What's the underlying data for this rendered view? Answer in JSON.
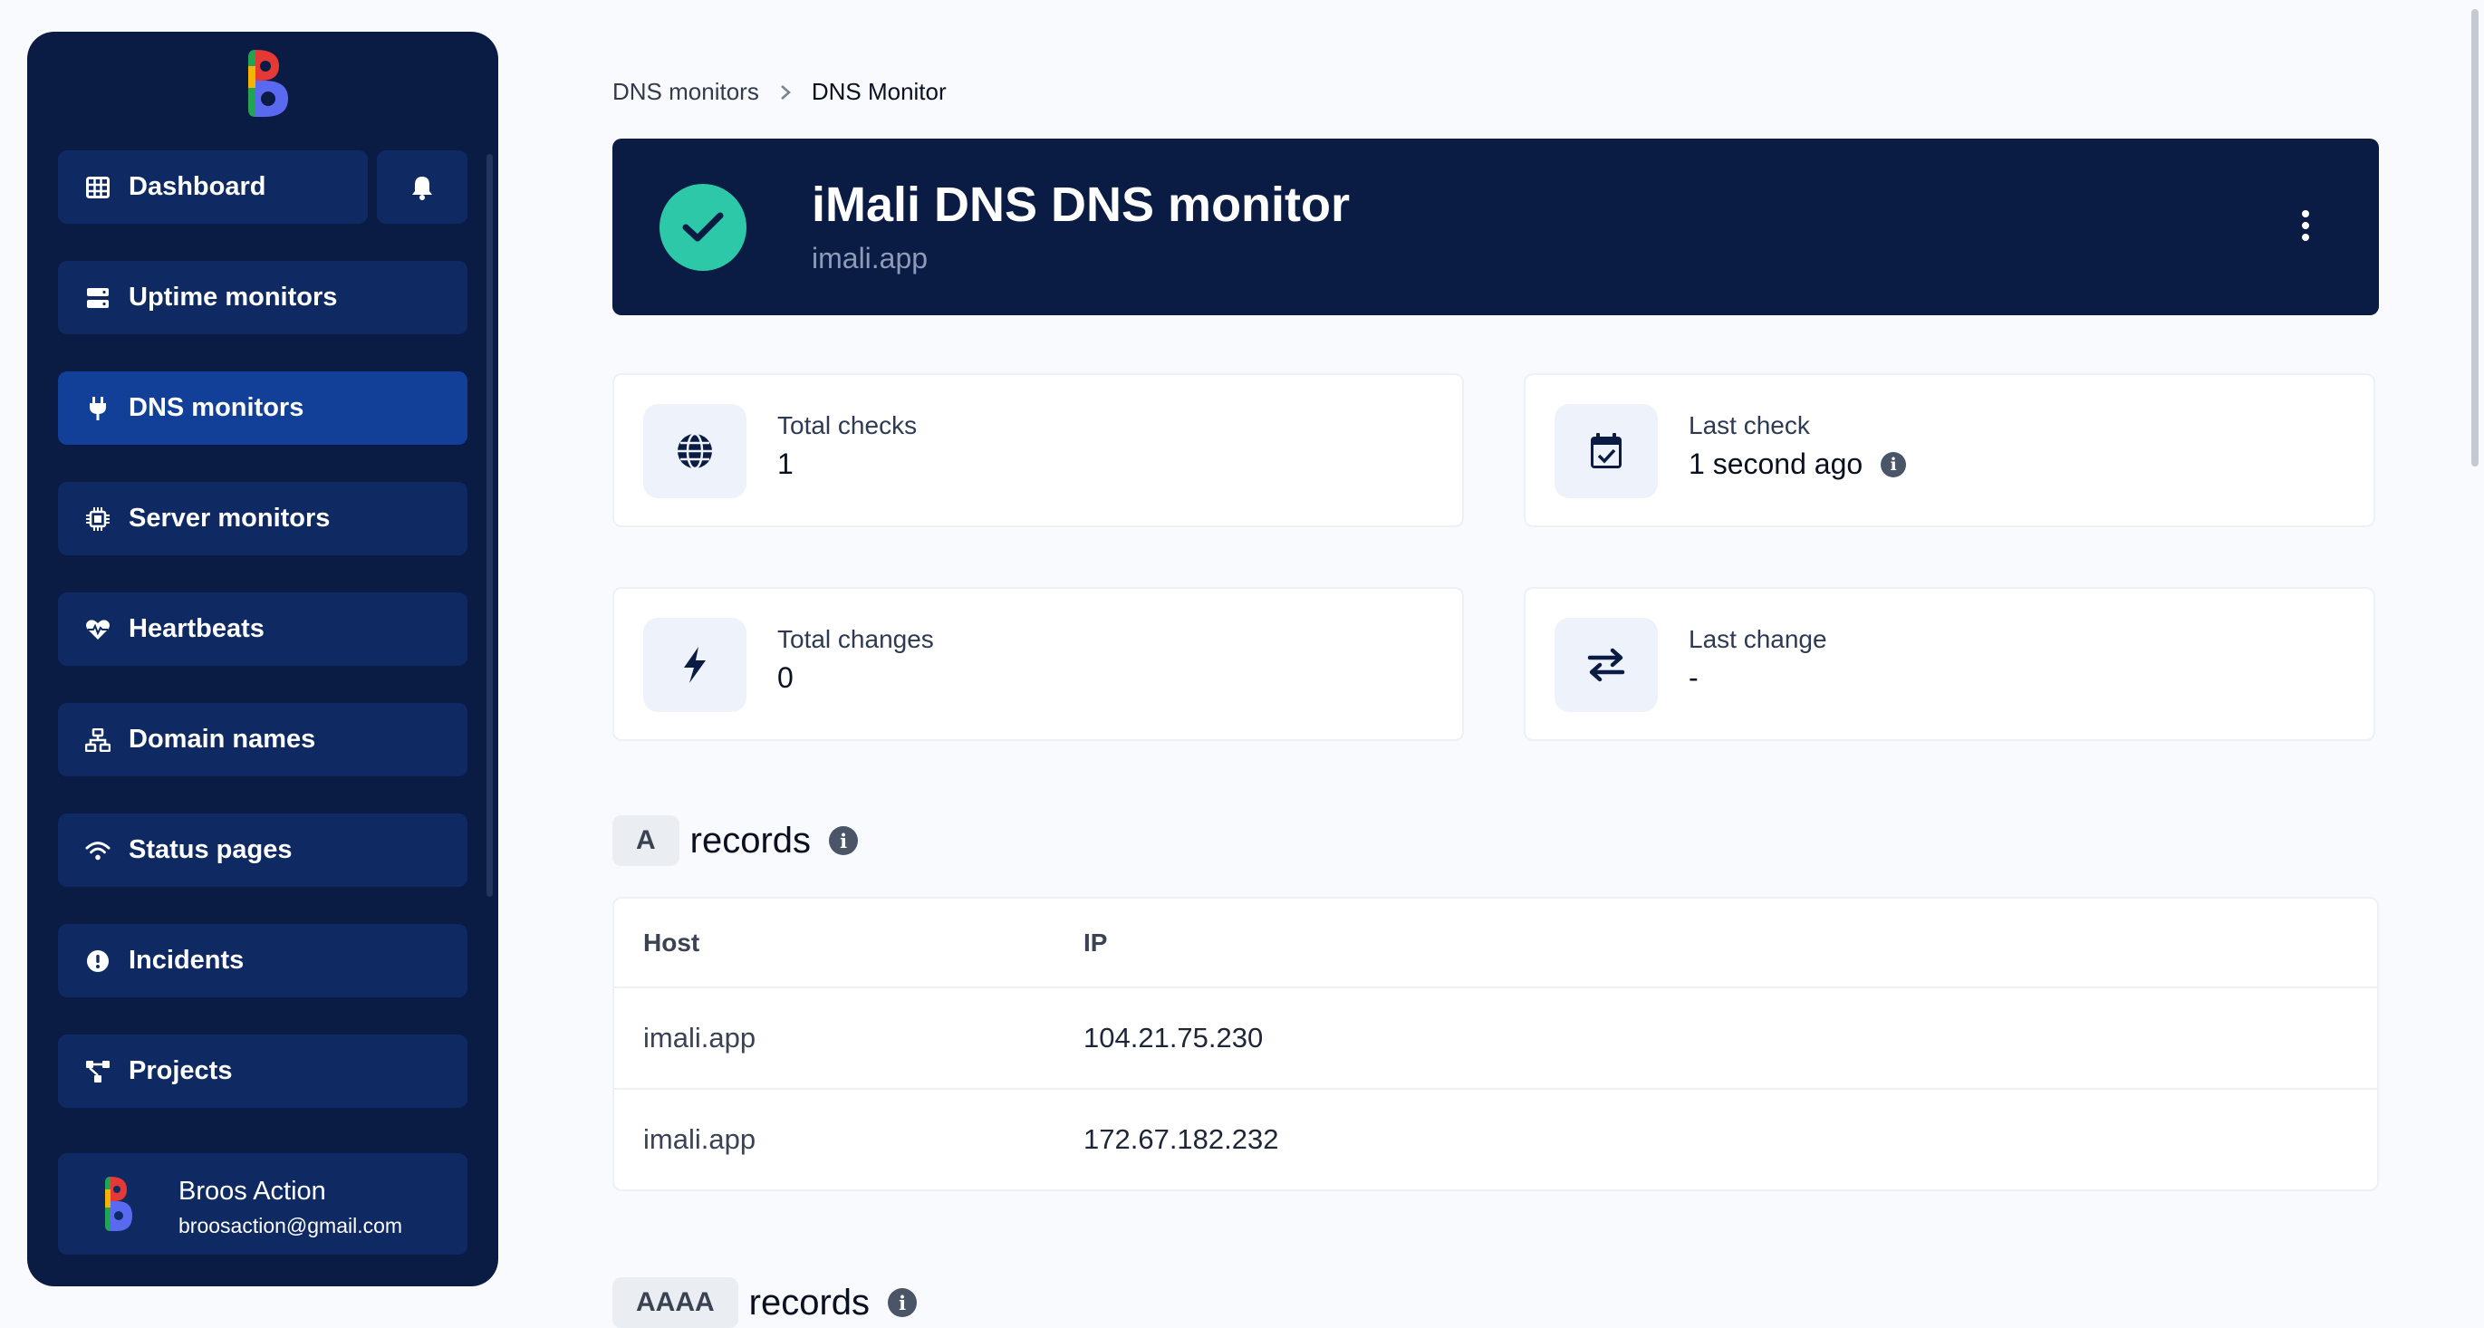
{
  "sidebar": {
    "items": [
      {
        "label": "Dashboard"
      },
      {
        "label": "Uptime monitors"
      },
      {
        "label": "DNS monitors"
      },
      {
        "label": "Server monitors"
      },
      {
        "label": "Heartbeats"
      },
      {
        "label": "Domain names"
      },
      {
        "label": "Status pages"
      },
      {
        "label": "Incidents"
      },
      {
        "label": "Projects"
      }
    ],
    "active_item": "DNS monitors",
    "user": {
      "name": "Broos Action",
      "email": "broosaction@gmail.com"
    }
  },
  "breadcrumb": {
    "parent": "DNS monitors",
    "current": "DNS Monitor"
  },
  "monitor": {
    "title": "iMali DNS DNS monitor",
    "subtitle": "imali.app",
    "status": "up"
  },
  "stats": {
    "total_checks": {
      "label": "Total checks",
      "value": "1"
    },
    "last_check": {
      "label": "Last check",
      "value": "1 second ago"
    },
    "total_changes": {
      "label": "Total changes",
      "value": "0"
    },
    "last_change": {
      "label": "Last change",
      "value": "-"
    }
  },
  "records_a": {
    "badge": "A",
    "word": "records",
    "columns": {
      "host": "Host",
      "ip": "IP"
    },
    "rows": [
      {
        "host": "imali.app",
        "ip": "104.21.75.230"
      },
      {
        "host": "imali.app",
        "ip": "172.67.182.232"
      }
    ]
  },
  "records_aaaa": {
    "badge": "AAAA",
    "word": "records"
  },
  "colors": {
    "navy": "#0a1b44",
    "nav_item": "#0f2a63",
    "nav_active": "#123f97",
    "success": "#2cc8a8",
    "background": "#f8fafd"
  }
}
